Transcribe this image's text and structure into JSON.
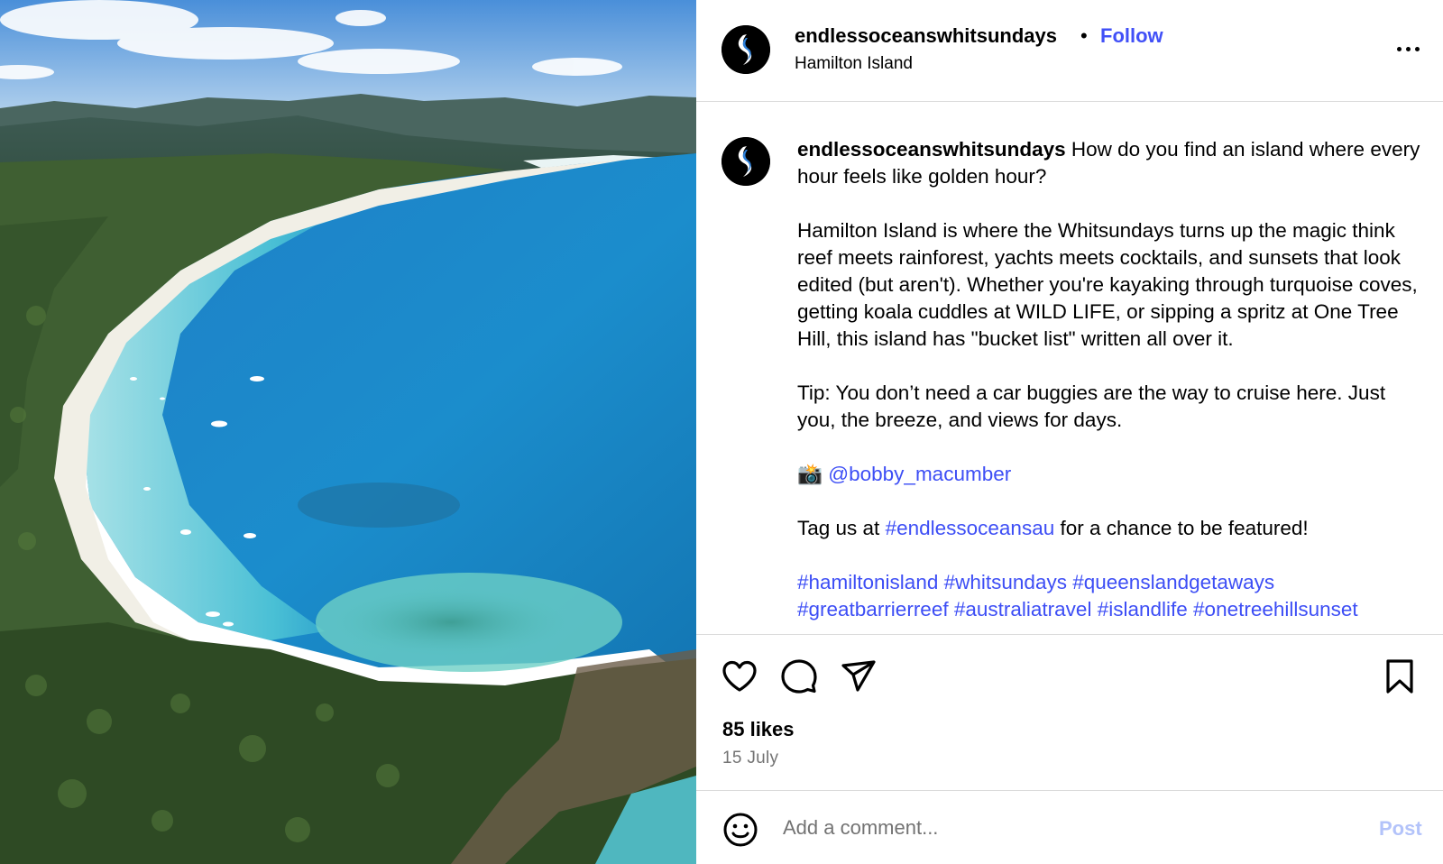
{
  "post": {
    "image_alt": "Aerial view of a curved white sand beach with turquoise water, moored boats and forested hills"
  },
  "header": {
    "username": "endlessoceanswhitsundays",
    "separator": "•",
    "follow_label": "Follow",
    "location": "Hamilton Island"
  },
  "caption": {
    "username": "endlessoceanswhitsundays",
    "intro": "How do you find an island where every hour feels like golden hour?",
    "paragraph1": "Hamilton Island is where the Whitsundays turns up the magic think reef meets rainforest, yachts meets cocktails, and sunsets that look edited (but aren't). Whether you're kayaking through turquoise coves, getting koala cuddles at WILD LIFE, or sipping a spritz at One Tree Hill, this island has \"bucket list\" written all over it.",
    "paragraph2": "Tip: You don’t need a car buggies are the way to cruise here. Just you, the breeze, and views for days.",
    "camera_emoji": "📸",
    "photo_credit": "@bobby_macumber",
    "tag_prefix": "Tag us at",
    "tag_link": "#endlessoceansau",
    "tag_suffix": "for a chance to be featured!",
    "hashtags": [
      "#hamiltonisland",
      "#whitsundays",
      "#queenslandgetaways",
      "#greatbarrierreef",
      "#australiatravel",
      "#islandlife",
      "#onetreehillsunset"
    ]
  },
  "actions": {
    "likes": "85 likes",
    "date": "15 July"
  },
  "comment": {
    "placeholder": "Add a comment...",
    "post_label": "Post"
  },
  "colors": {
    "link": "#3d4ef5",
    "follow": "#4150f7",
    "post_disabled": "#b3c3fa",
    "secondary_text": "#737373",
    "divider": "#dbdbdb"
  },
  "icons": [
    "more-options-icon",
    "heart-icon",
    "comment-icon",
    "share-icon",
    "bookmark-icon",
    "emoji-icon",
    "brand-wave-logo-icon"
  ]
}
